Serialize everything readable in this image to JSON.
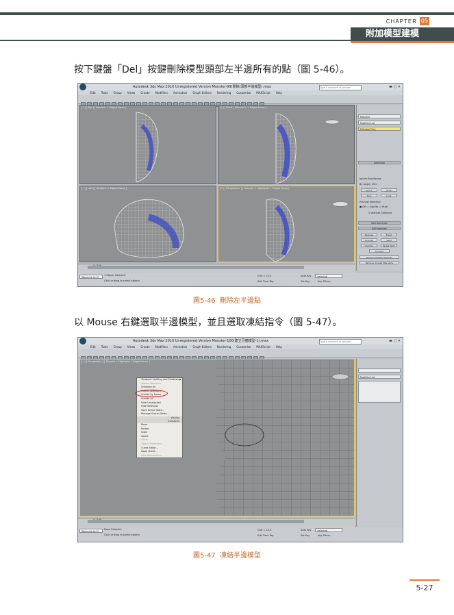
{
  "header": {
    "chapter_label": "CHAPTER",
    "chapter_number": "05",
    "section_title": "附加模型建模"
  },
  "paragraph1": "按下鍵盤「Del」按鍵刪除模型頭部左半邊所有的點（圖 5-46）。",
  "figure1": {
    "caption_number": "圖5-46",
    "caption_text": "刪除左半邊點",
    "window_title": "Autodesk 3ds Max 2010    Unregistered Version    Monster-99(刪除(頭部半邊模型).max",
    "search_placeholder": "Type a keyword or phrase",
    "menu": [
      "Edit",
      "Tools",
      "Group",
      "Views",
      "Create",
      "Modifiers",
      "Animation",
      "Graph Editors",
      "Rendering",
      "Customize",
      "MAXScript",
      "Help"
    ],
    "viewport_labels": [
      "[+] [ Top ] [ Realistic + Edged Faces ]",
      "[+] [ Front ] [ Realistic + Edged Faces ]",
      "[+] [ Left ] [ Realistic + Edged Faces ]",
      "[+] [ Perspective ] [ Smooth + Highlights + Edged Faces ]"
    ],
    "panel": {
      "object_name": "Monster",
      "modifier_list": "Modifier List",
      "stack_item": "Editable Poly",
      "selection_head": "Selection",
      "ignore_backfacing": "Ignore Backfacing",
      "by_angle": "By Angle: 45.0",
      "shrink": "Shrink",
      "grow": "Grow",
      "ring": "Ring",
      "loop": "Loop",
      "preview_selection": "Preview Selection",
      "preview_options": "● Off   ○ SubObj   ○ Multi",
      "vertices_selected": "0 Vertices Selected",
      "soft_selection": "Soft Selection",
      "edit_vertices": "Edit Vertices",
      "remove": "Remove",
      "break": "Break",
      "extrude": "Extrude",
      "weld": "Weld",
      "chamfer": "Chamfer",
      "target_weld": "Target Weld",
      "connect": "Connect",
      "remove_isolated": "Remove Isolated Vertices",
      "remove_unused": "Remove Unused Map Verts"
    },
    "time_slider": "0 / 100",
    "status": {
      "objects": "1 Object Selected",
      "prompt": "Click or drag to select objects",
      "grid": "Grid = 10.0",
      "auto_key": "Auto Key",
      "set_key": "Set Key",
      "selected": "Selected",
      "key_filters": "Key Filters...",
      "welcome": "Welcome to M",
      "add_time_tag": "Add Time Tag"
    }
  },
  "paragraph2": "以 Mouse 右鍵選取半邊模型，並且選取凍結指令（圖 5-47）。",
  "figure2": {
    "caption_number": "圖5-47",
    "caption_text": "凍結半邊模型",
    "window_title": "Autodesk 3ds Max 2010    Unregistered Version    Monster-100(建立牙齒模型-1).max",
    "viewport_label": "[+] [ Perspective ] [ Smooth + Highlight + Edged Faces ]",
    "modifier_list": "Modifier List",
    "context_menu": {
      "top_items": [
        {
          "label": "Viewport Lighting and Shadows ▶",
          "dim": false
        },
        {
          "label": "Isolate Selection",
          "dim": true
        },
        {
          "label": "Unfreeze All",
          "dim": false
        },
        {
          "label": "Freeze Selection",
          "dim": false
        },
        {
          "label": "Unhide by Name",
          "dim": false
        },
        {
          "label": "Unhide All",
          "dim": false
        },
        {
          "label": "Hide Unselected",
          "dim": false
        },
        {
          "label": "Hide Selection",
          "dim": false
        },
        {
          "label": "Save Scene State...",
          "dim": false
        },
        {
          "label": "Manage Scene States...",
          "dim": false
        }
      ],
      "display_label": "display",
      "transform_label": "transform",
      "bottom_items": [
        {
          "label": "Move",
          "dim": false
        },
        {
          "label": "Rotate",
          "dim": false
        },
        {
          "label": "Scale",
          "dim": false
        },
        {
          "label": "Select",
          "dim": false
        },
        {
          "label": "Clone",
          "dim": true
        },
        {
          "label": "Object Properties...",
          "dim": true
        },
        {
          "label": "Curve Editor...",
          "dim": false
        },
        {
          "label": "Dope Sheet...",
          "dim": false
        },
        {
          "label": "Wire Parameters...",
          "dim": true
        }
      ]
    },
    "time_slider": "0 / 100",
    "status": {
      "objects": "None Selected",
      "prompt": "Click or drag to select objects",
      "grid": "Grid = 10.0",
      "auto_key": "Auto Key",
      "set_key": "Set Key",
      "selected": "Selected",
      "key_filters": "Key Filters...",
      "welcome": "Welcome to M",
      "add_time_tag": "Add Time Tag"
    }
  },
  "page_number": "5-27"
}
